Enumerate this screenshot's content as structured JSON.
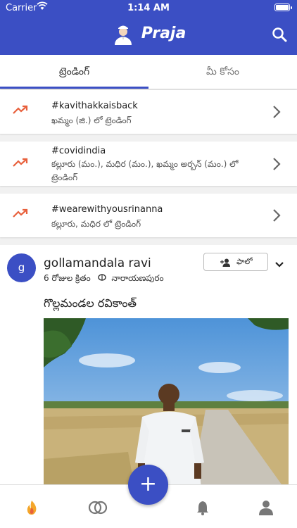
{
  "status_bar": {
    "carrier": "Carrier",
    "time": "1:14 AM"
  },
  "header": {
    "app_name": "Praja"
  },
  "tabs": [
    {
      "label": "ట్రెండింగ్",
      "active": true
    },
    {
      "label": "మీ కోసం",
      "active": false
    }
  ],
  "trending": [
    {
      "tag": "#kavithakkaisback",
      "subtitle": "ఖమ్మం (జి.) లో ట్రెండింగ్"
    },
    {
      "tag": "#covidindia",
      "subtitle": "కల్లూరు (మం.), మధిర (మం.), ఖమ్మం అర్బన్ (మం.) లో ట్రెండింగ్"
    },
    {
      "tag": "#wearewithyousrinanna",
      "subtitle": "కల్లూరు, మధిర లో ట్రెండింగ్"
    }
  ],
  "post": {
    "avatar_letter": "g",
    "author": "gollamandala ravi",
    "time_ago": "6 రోజుల క్రితం",
    "location": "నారాయణపురం",
    "follow_label": "ఫాలో",
    "caption": "గొల్లమండల రవికాంత్"
  },
  "colors": {
    "primary": "#3b4fc4",
    "trend_accent": "#e8603c"
  },
  "icons": {
    "search": "search-icon",
    "trend": "trending-up-icon",
    "chevron": "chevron-right-icon",
    "nav": [
      "home-flame-icon",
      "rings-icon",
      "bell-icon",
      "profile-icon"
    ],
    "fab": "plus-icon"
  }
}
